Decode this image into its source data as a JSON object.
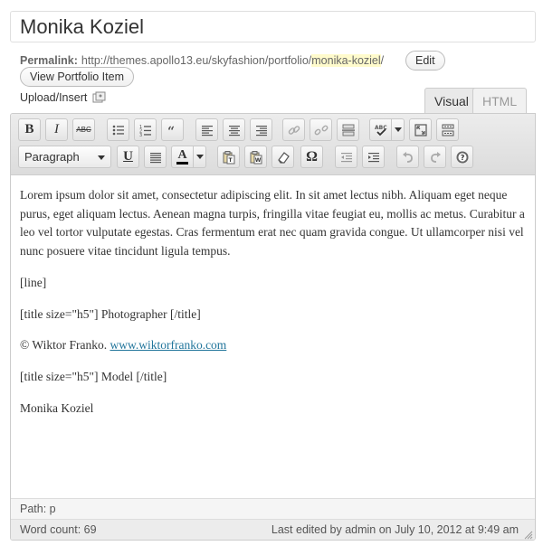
{
  "post": {
    "title": "Monika Koziel"
  },
  "permalink": {
    "label": "Permalink:",
    "url_base": "http://themes.apollo13.eu/skyfashion/portfolio/",
    "slug": "monika-koziel",
    "trailing": "/",
    "edit_label": "Edit",
    "view_label": "View Portfolio Item"
  },
  "media": {
    "upload_label": "Upload/Insert",
    "icon": "media-icon"
  },
  "tabs": {
    "visual": "Visual",
    "html": "HTML"
  },
  "toolbar": {
    "format_value": "Paragraph",
    "row1_icons": [
      "bold-icon",
      "italic-icon",
      "strikethrough-icon",
      "bullet-list-icon",
      "numbered-list-icon",
      "blockquote-icon",
      "align-left-icon",
      "align-center-icon",
      "align-right-icon",
      "link-icon",
      "unlink-icon",
      "more-tag-icon",
      "spellcheck-icon",
      "fullscreen-icon",
      "kitchen-sink-icon"
    ],
    "row2_icons": [
      "underline-icon",
      "justify-icon",
      "text-color-icon",
      "paste-text-icon",
      "paste-word-icon",
      "clear-formatting-icon",
      "special-char-icon",
      "outdent-icon",
      "indent-icon",
      "undo-icon",
      "redo-icon",
      "help-icon"
    ],
    "bold_glyph": "B",
    "italic_glyph": "I",
    "strike_glyph": "ABC",
    "underline_glyph": "U",
    "textcolor_glyph": "A",
    "omega_glyph": "Ω"
  },
  "content": {
    "paragraph1": "Lorem ipsum dolor sit amet, consectetur adipiscing elit. In sit amet lectus nibh. Aliquam eget neque purus, eget aliquam lectus. Aenean magna turpis, fringilla vitae feugiat eu, mollis ac metus. Curabitur a leo vel tortor vulputate egestas. Cras fermentum erat nec quam gravida congue. Ut ullamcorper nisi vel nunc posuere vitae tincidunt ligula tempus.",
    "line_tag": "[line]",
    "title_photographer": "[title size=\"h5\"] Photographer [/title]",
    "credit_prefix": "© Wiktor Franko. ",
    "credit_link": "www.wiktorfranko.com",
    "title_model": "[title size=\"h5\"] Model [/title]",
    "model_name": "Monika Koziel"
  },
  "status": {
    "path_label": "Path:",
    "path_value": "p",
    "word_count_label": "Word count:",
    "word_count": "69",
    "last_edited": "Last edited by admin on July 10, 2012 at 9:49 am"
  }
}
